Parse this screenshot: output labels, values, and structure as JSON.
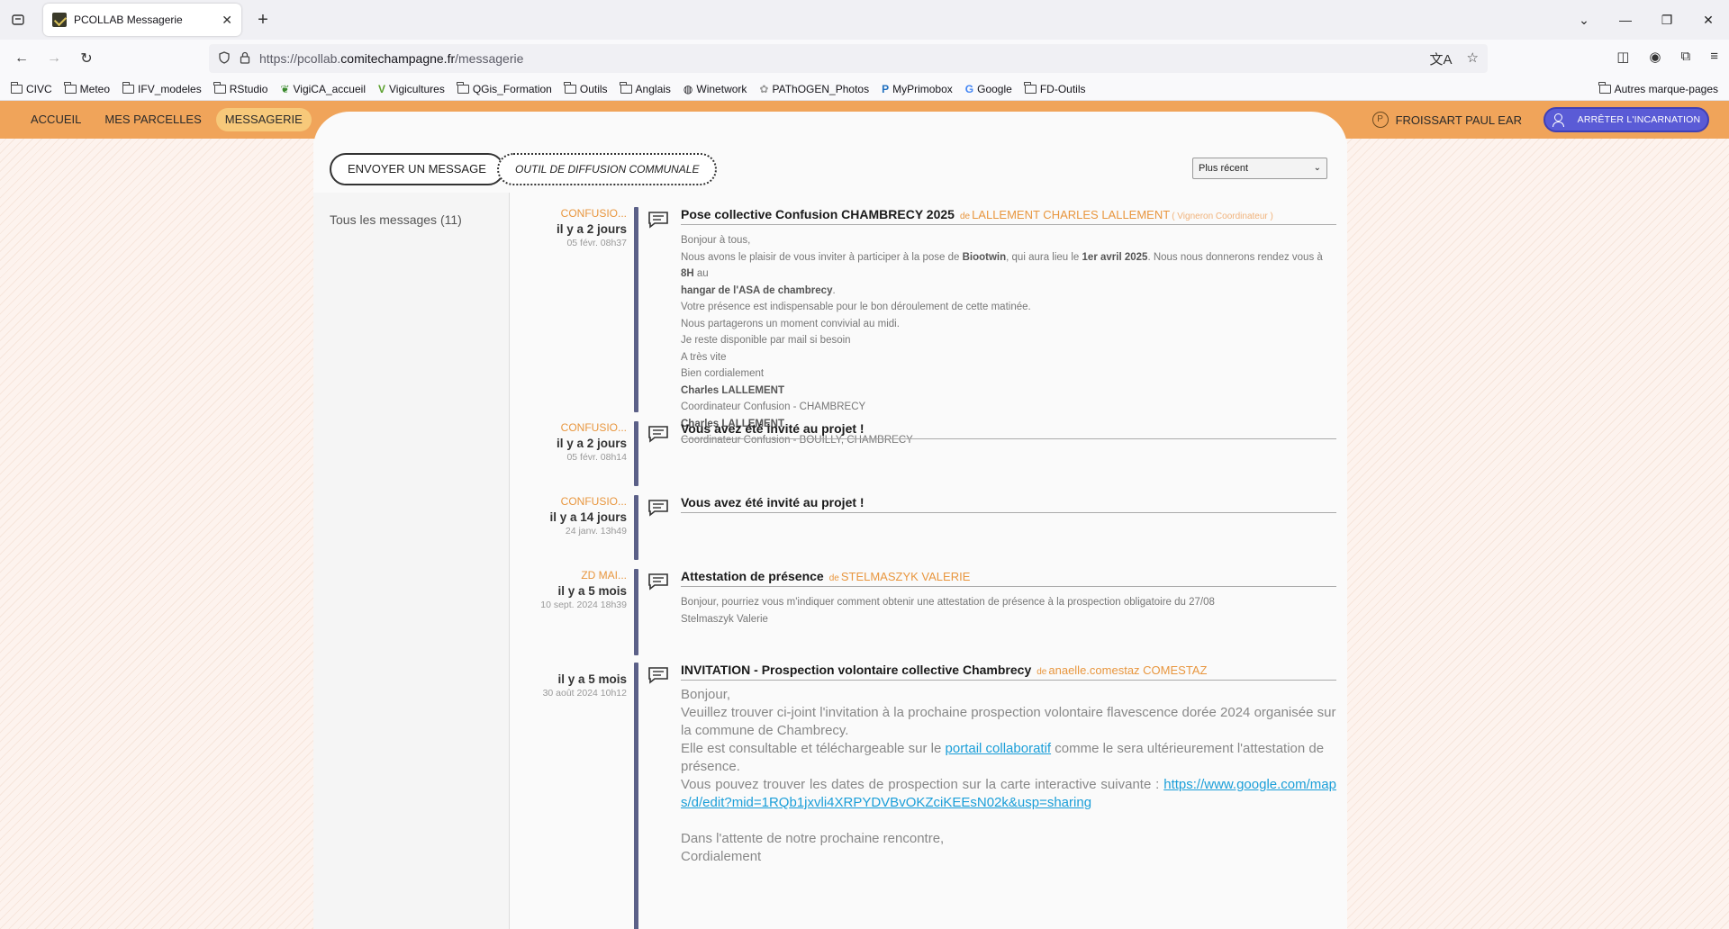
{
  "browser": {
    "tab_title": "PCOLLAB Messagerie",
    "url_prefix": "https://pcollab.",
    "url_domain": "comitechampagne.fr",
    "url_path": "/messagerie",
    "bookmarks": [
      "CIVC",
      "Meteo",
      "IFV_modeles",
      "RStudio",
      "VigiCA_accueil",
      "Vigicultures",
      "QGis_Formation",
      "Outils",
      "Anglais",
      "Winetwork",
      "PAThOGEN_Photos",
      "MyPrimobox",
      "Google",
      "FD-Outils"
    ],
    "bookmarks_other": "Autres marque-pages"
  },
  "nav": {
    "items": [
      "ACCUEIL",
      "MES PARCELLES",
      "MESSAGERIE"
    ],
    "active": "MESSAGERIE",
    "user_name": "FROISSART PAUL EAR",
    "stop_label": "ARRÊTER L'INCARNATION"
  },
  "toolbar": {
    "send_label": "ENVOYER UN MESSAGE",
    "tool_label": "OUTIL DE DIFFUSION COMMUNALE",
    "sort_value": "Plus récent"
  },
  "sidebar": {
    "all_messages": "Tous les messages (11)"
  },
  "messages": [
    {
      "group": "CONFUSIO...",
      "ago": "il y a 2 jours",
      "date": "05 févr. 08h37",
      "title": "Pose collective Confusion CHAMBRECY 2025",
      "de": "de",
      "author": "LALLEMENT CHARLES LALLEMENT",
      "role": "( Vigneron Coordinateur )",
      "lines": {
        "l1": "Bonjour à tous,",
        "l2a": "Nous avons le plaisir de vous inviter à participer à la pose de ",
        "l2b": "Biootwin",
        "l2c": ", qui aura lieu le ",
        "l2d": "1er avril 2025",
        "l2e": ". Nous nous donnerons rendez vous à ",
        "l2f": "8H",
        "l2g": " au",
        "l3a": "hangar de l'ASA de chambrecy",
        "l3b": ".",
        "l4": "Votre présence est indispensable pour le bon déroulement de cette matinée.",
        "l5": "Nous partagerons un moment convivial au midi.",
        "l6": "Je reste disponible par mail si besoin",
        "l7": "A très vite",
        "l8": "Bien cordialement",
        "l9": "Charles LALLEMENT",
        "l10": "Coordinateur Confusion - CHAMBRECY",
        "l11": "Charles LALLEMENT",
        "l12": "Coordinateur Confusion - BOUILLY, CHAMBRECY"
      }
    },
    {
      "group": "CONFUSIO...",
      "ago": "il y a 2 jours",
      "date": "05 févr. 08h14",
      "title": "Vous avez été invité au projet !"
    },
    {
      "group": "CONFUSIO...",
      "ago": "il y a 14 jours",
      "date": "24 janv. 13h49",
      "title": "Vous avez été invité au projet !"
    },
    {
      "group": "ZD MAI...",
      "ago": "il y a 5 mois",
      "date": "10 sept. 2024 18h39",
      "title": "Attestation de présence",
      "de": "de",
      "author": "STELMASZYK VALERIE",
      "lines": {
        "l1": "Bonjour, pourriez vous m'indiquer comment obtenir une attestation de présence à la prospection obligatoire du 27/08",
        "l2": "Stelmaszyk Valerie"
      }
    },
    {
      "group": "",
      "ago": "il y a 5 mois",
      "date": "30 août 2024 10h12",
      "title": "INVITATION - Prospection volontaire collective Chambrecy",
      "de": "de",
      "author": "anaelle.comestaz COMESTAZ",
      "lines": {
        "l1": "Bonjour,",
        "l2": "Veuillez trouver ci-joint l'invitation à la prochaine prospection volontaire flavescence dorée 2024 organisée sur la commune de Chambrecy.",
        "l3a": "Elle est consultable et téléchargeable sur le ",
        "l3link": "portail collaboratif",
        "l3b": " comme le sera ultérieurement l'attestation de présence.",
        "l4a": "Vous pouvez trouver les dates de prospection sur la carte interactive suivante : ",
        "l4link": "https://www.google.com/maps/d/edit?mid=1RQb1jxvli4XRPYDVBvOKZciKEEsN02k&usp=sharing",
        "l6": "Dans l'attente de notre prochaine rencontre,",
        "l7": "Cordialement"
      }
    }
  ]
}
